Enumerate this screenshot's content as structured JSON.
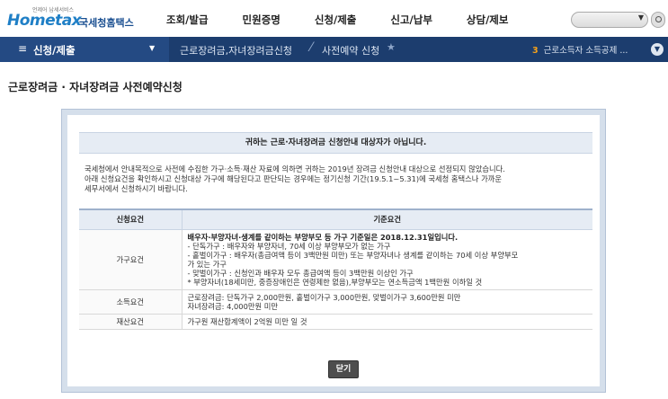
{
  "header": {
    "logo_small": "언제어 납세서비스",
    "logo_brand": "Hometax",
    "logo_korean": "국세청홈택스",
    "gnb": [
      "조회/발급",
      "민원증명",
      "신청/제출",
      "신고/납부",
      "상담/제보"
    ]
  },
  "nav": {
    "menu_label": "신청/제출",
    "crumb1": "근로장려금,자녀장려금신청",
    "crumb2": "사전예약 신청",
    "quick_num": "3",
    "quick_text": "근로소득자 소득공제 ..."
  },
  "page_title": "근로장려금 · 자녀장려금 사전예약신청",
  "modal": {
    "notice": "귀하는 근로·자녀장려금 신청안내 대상자가 아닙니다.",
    "desc": [
      "국세청에서 안내목적으로 사전에 수집한 가구·소득·재산 자료에 의하면 귀하는 2019년 장려금 신청안내 대상으로 선정되지 않았습니다.",
      "아래 신청요건을 확인하시고 신청대상 가구에 해당된다고 판단되는 경우에는 정기신청 기간(19.5.1~5.31)에 국세청 홈택스나 가까운",
      "세무서에서 신청하시기 바랍니다."
    ],
    "table": {
      "headers": [
        "신청요건",
        "기준요건"
      ],
      "rows": [
        {
          "key": "가구요건",
          "lines": [
            "배우자·부양자녀·생계를 같이하는 부양부모 등 가구 기준일은 2018.12.31일입니다.",
            "- 단독가구 : 배우자와 부양자녀, 70세 이상 부양부모가 없는 가구",
            "- 홑벌이가구 : 배우자(총급여액 등이 3백만원 미만) 또는 부양자녀나 생계를 같이하는 70세 이상 부양부모",
            "가 있는 가구",
            "- 맞벌이가구 : 신청인과 배우자 모두 총급여액 등이 3백만원 이상인 가구",
            "* 부양자녀(18세미만, 중증장애인은 연령제한 없음),부양부모는 연소득금액 1백만원 이하일 것"
          ]
        },
        {
          "key": "소득요건",
          "lines": [
            "근로장려금: 단독가구 2,000만원, 홑벌이가구 3,000만원, 맞벌이가구 3,600만원 미만",
            "자녀장려금: 4,000만원 미만"
          ]
        },
        {
          "key": "재산요건",
          "lines": [
            "가구원 재산합계액이 2억원 미만 일 것"
          ]
        }
      ]
    },
    "close_label": "닫기"
  }
}
